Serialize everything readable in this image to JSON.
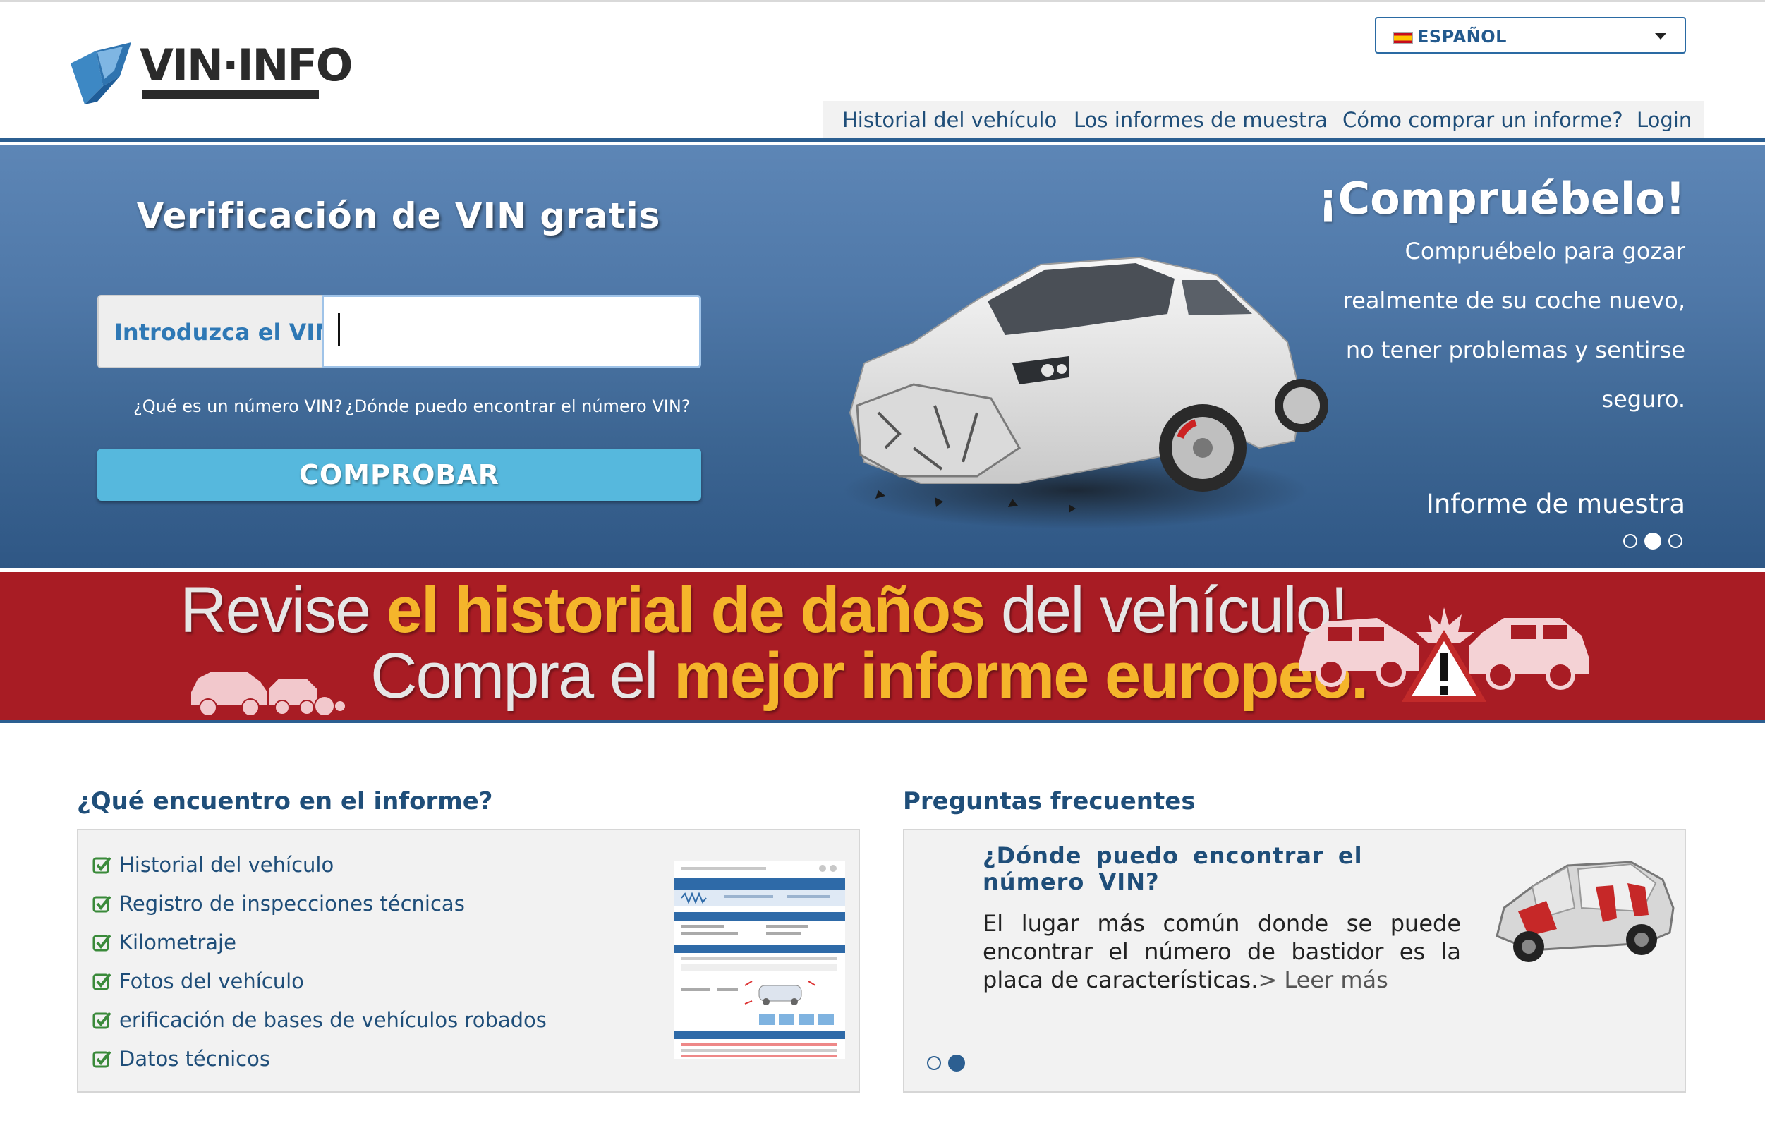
{
  "header": {
    "logo_text": "VIN·INFO",
    "language": {
      "flag": "spanish-flag",
      "label": "ESPAÑOL"
    },
    "nav": [
      {
        "label": "Historial del vehículo"
      },
      {
        "label": "Los informes de muestra"
      },
      {
        "label": "Cómo comprar un informe?"
      },
      {
        "label": "Login"
      }
    ]
  },
  "hero": {
    "title": "Verificación de VIN gratis",
    "vin_label": "Introduzca el VIN",
    "vin_value": "",
    "help_links": [
      {
        "label": "¿Qué es un número VIN?"
      },
      {
        "label": "¿Dónde puedo encontrar el número VIN?"
      }
    ],
    "check_button": "COMPROBAR",
    "promo": {
      "title": "¡Compruébelo!",
      "lines": [
        "Compruébelo para gozar",
        "realmente de su coche nuevo,",
        "no tener problemas y sentirse",
        "seguro."
      ],
      "sample_link": "Informe de muestra"
    },
    "carousel": {
      "count": 3,
      "active_index": 1
    }
  },
  "banner": {
    "line1_part1": "Revise ",
    "line1_highlight": "el historial de daños",
    "line1_part2": " del vehículo!",
    "line2_part1": "Compra el ",
    "line2_highlight": "mejor informe europeo."
  },
  "report_section": {
    "title": "¿Qué encuentro en el informe?",
    "features": [
      {
        "label": "Historial del vehículo"
      },
      {
        "label": "Registro de inspecciones técnicas"
      },
      {
        "label": "Kilometraje"
      },
      {
        "label": "Fotos del vehículo"
      },
      {
        "label": "erificación de bases de vehículos robados"
      },
      {
        "label": "Datos técnicos"
      }
    ]
  },
  "faq_section": {
    "title": "Preguntas frecuentes",
    "question": "¿Dónde puedo encontrar el número VIN?",
    "answer": "El lugar más común donde se puede encontrar el número de bastidor es la placa de características.",
    "read_more": "> Leer más",
    "carousel": {
      "count": 2,
      "active_index": 1
    }
  },
  "colors": {
    "brand_blue": "#1f4e79",
    "accent_blue": "#56b8dd",
    "banner_red": "#a81c24",
    "highlight_yellow": "#f5b52b"
  }
}
